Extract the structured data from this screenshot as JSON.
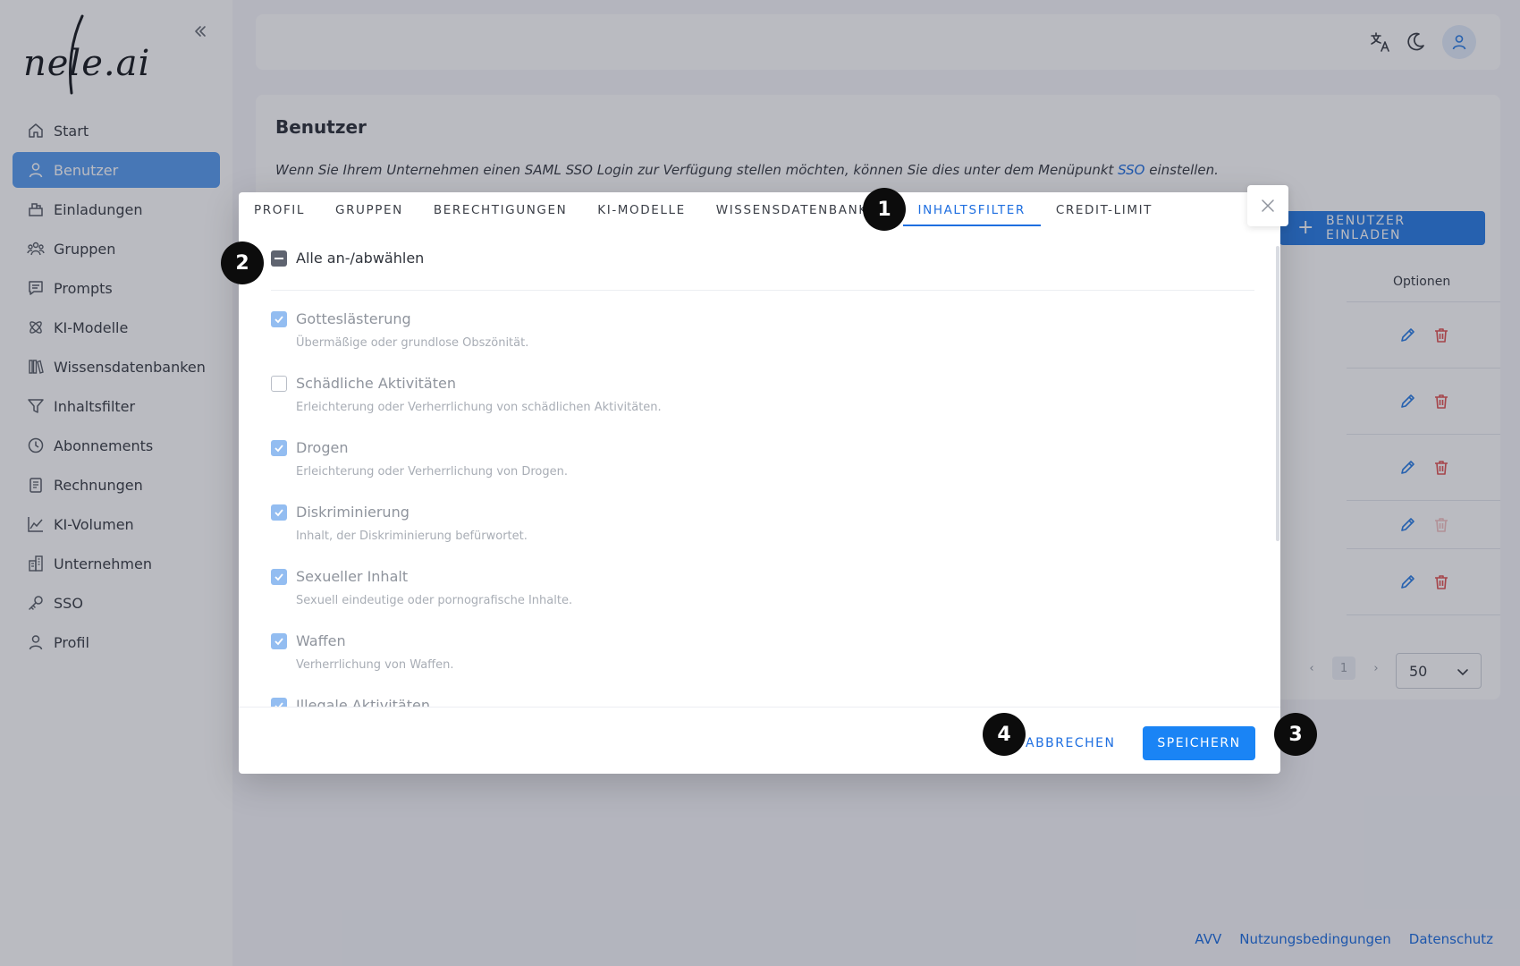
{
  "brand": {
    "logo_text": "nele.ai"
  },
  "sidebar": {
    "items": [
      {
        "label": "Start",
        "icon": "home-icon"
      },
      {
        "label": "Benutzer",
        "icon": "user-icon"
      },
      {
        "label": "Einladungen",
        "icon": "invitation-icon"
      },
      {
        "label": "Gruppen",
        "icon": "groups-icon"
      },
      {
        "label": "Prompts",
        "icon": "prompts-icon"
      },
      {
        "label": "KI-Modelle",
        "icon": "ai-models-icon"
      },
      {
        "label": "Wissensdatenbanken",
        "icon": "library-icon"
      },
      {
        "label": "Inhaltsfilter",
        "icon": "filter-icon"
      },
      {
        "label": "Abonnements",
        "icon": "clock-icon"
      },
      {
        "label": "Rechnungen",
        "icon": "invoice-icon"
      },
      {
        "label": "KI-Volumen",
        "icon": "chart-icon"
      },
      {
        "label": "Unternehmen",
        "icon": "building-icon"
      },
      {
        "label": "SSO",
        "icon": "key-icon"
      },
      {
        "label": "Profil",
        "icon": "profile-icon"
      }
    ],
    "active": "Benutzer"
  },
  "page": {
    "title": "Benutzer",
    "info_text_before": "Wenn Sie Ihrem Unternehmen einen SAML SSO Login zur Verfügung stellen möchten, können Sie dies unter dem Menüpunkt ",
    "info_link": "SSO",
    "info_text_after": " einstellen.",
    "invite_button": "BENUTZER EINLADEN",
    "column_options": "Optionen",
    "per_page": "50",
    "current_page": "1"
  },
  "modal": {
    "tabs": [
      "PROFIL",
      "GRUPPEN",
      "BERECHTIGUNGEN",
      "KI-MODELLE",
      "WISSENSDATENBANKEN",
      "INHALTSFILTER",
      "CREDIT-LIMIT"
    ],
    "active_tab": "INHALTSFILTER",
    "select_all_label": "Alle an-/abwählen",
    "filters": [
      {
        "label": "Gotteslästerung",
        "desc": "Übermäßige oder grundlose Obszönität.",
        "checked": true
      },
      {
        "label": "Schädliche Aktivitäten",
        "desc": "Erleichterung oder Verherrlichung von schädlichen Aktivitäten.",
        "checked": false
      },
      {
        "label": "Drogen",
        "desc": "Erleichterung oder Verherrlichung von Drogen.",
        "checked": true
      },
      {
        "label": "Diskriminierung",
        "desc": "Inhalt, der Diskriminierung befürwortet.",
        "checked": true
      },
      {
        "label": "Sexueller Inhalt",
        "desc": "Sexuell eindeutige oder pornografische Inhalte.",
        "checked": true
      },
      {
        "label": "Waffen",
        "desc": "Verherrlichung von Waffen.",
        "checked": true
      },
      {
        "label": "Illegale Aktivitäten",
        "desc": "",
        "checked": true
      }
    ],
    "cancel_label": "ABBRECHEN",
    "save_label": "SPEICHERN"
  },
  "badges": [
    "1",
    "2",
    "3",
    "4"
  ],
  "footer": {
    "links": [
      "AVV",
      "Nutzungsbedingungen",
      "Datenschutz"
    ]
  },
  "colors": {
    "accent": "#1f6fe0",
    "save": "#1a84f5",
    "danger": "#e25555",
    "checkbox_on": "#93bdf1"
  }
}
